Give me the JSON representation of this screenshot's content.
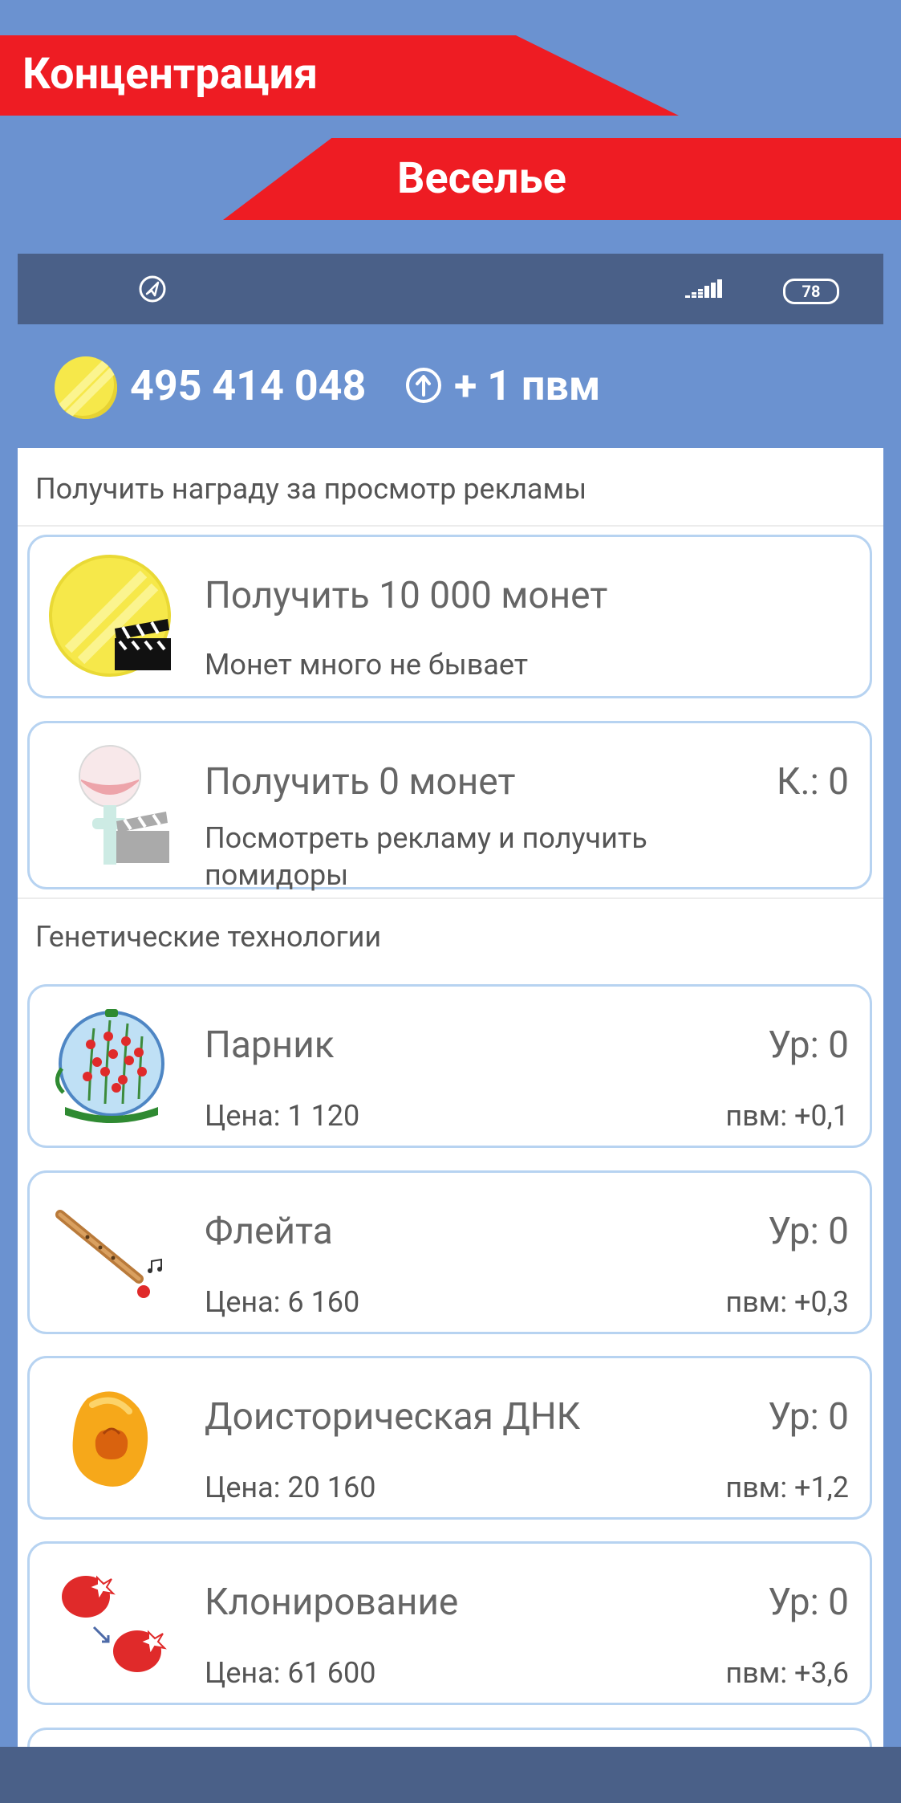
{
  "banners": {
    "top": "Концентрация",
    "second": "Веселье"
  },
  "status_bar": {
    "battery": "78"
  },
  "header": {
    "money": "495 414 048",
    "rate": "+ 1 пвм"
  },
  "ads_section": {
    "title": "Получить награду за просмотр рекламы",
    "cards": [
      {
        "title": "Получить 10 000 монет",
        "subtitle": "Монет много не бывает"
      },
      {
        "title": "Получить 0 монет",
        "counter": "К.: 0",
        "subtitle": "Посмотреть рекламу и получить помидоры"
      }
    ]
  },
  "genetics_section": {
    "title": "Генетические технологии",
    "items": [
      {
        "name": "Парник",
        "level": "Ур: 0",
        "price": "Цена: 1 120",
        "income": "пвм: +0,1",
        "icon": "greenhouse-icon"
      },
      {
        "name": "Флейта",
        "level": "Ур: 0",
        "price": "Цена: 6 160",
        "income": "пвм: +0,3",
        "icon": "flute-icon"
      },
      {
        "name": "Доисторическая ДНК",
        "level": "Ур: 0",
        "price": "Цена: 20 160",
        "income": "пвм: +1,2",
        "icon": "amber-icon"
      },
      {
        "name": "Клонирование",
        "level": "Ур: 0",
        "price": "Цена: 61 600",
        "income": "пвм: +3,6",
        "icon": "cloning-icon"
      }
    ]
  },
  "colors": {
    "background": "#6b92d0",
    "banner": "#ee1c23",
    "statusbar": "#4a6088",
    "card_border": "#b7d3f1",
    "coin": "#f6e84a"
  }
}
